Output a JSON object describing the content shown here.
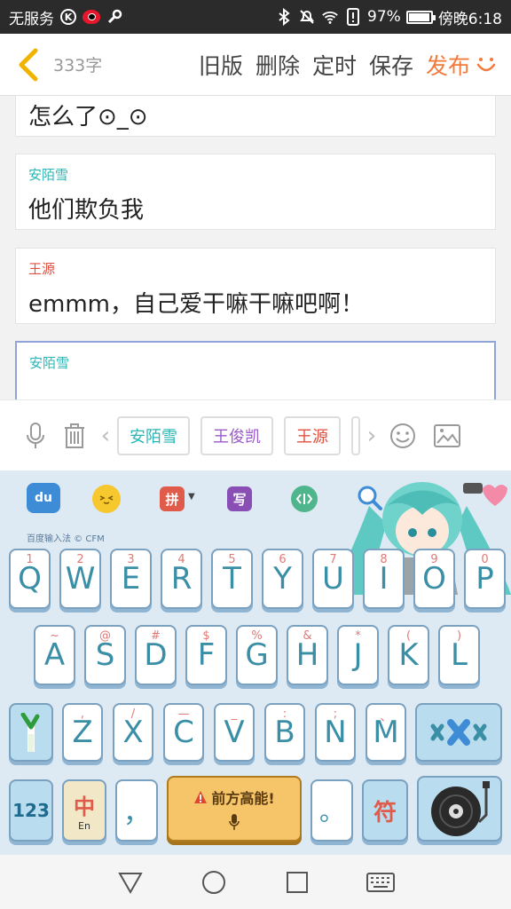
{
  "status_bar": {
    "carrier": "无服务",
    "battery_percent": "97%",
    "time": "傍晚6:18",
    "battery_level": 0.97,
    "icons": [
      "k-circle-icon",
      "weibo-icon",
      "wrench-icon",
      "bluetooth-icon",
      "mute-icon",
      "wifi-icon",
      "alert-icon",
      "battery-icon"
    ]
  },
  "header": {
    "word_count": "333字",
    "actions": [
      "旧版",
      "删除",
      "定时",
      "保存"
    ],
    "publish": "发布"
  },
  "messages": [
    {
      "speaker": "",
      "text": "怎么了⊙_⊙",
      "speaker_color": "#2bb5b5"
    },
    {
      "speaker": "安陌雪",
      "text": "他们欺负我",
      "speaker_color": "#2bb5b5"
    },
    {
      "speaker": "王源",
      "text": "emmm，自己爱干嘛干嘛吧啊！",
      "speaker_color": "#e05040"
    },
    {
      "speaker": "安陌雪",
      "text": "",
      "speaker_color": "#2bb5b5"
    }
  ],
  "quick_row": {
    "chips": [
      {
        "label": "安陌雪",
        "color": "#2bb5b5"
      },
      {
        "label": "王俊凯",
        "color": "#9a5ac8"
      },
      {
        "label": "王源",
        "color": "#e05040"
      }
    ]
  },
  "keyboard": {
    "brand": "百度输入法 © CFM",
    "toolbar": {
      "pinyin": "拼",
      "handwrite": "写",
      "du": "du"
    },
    "row1": [
      {
        "k": "Q",
        "s": "1"
      },
      {
        "k": "W",
        "s": "2"
      },
      {
        "k": "E",
        "s": "3"
      },
      {
        "k": "R",
        "s": "4"
      },
      {
        "k": "T",
        "s": "5"
      },
      {
        "k": "Y",
        "s": "6"
      },
      {
        "k": "U",
        "s": "7"
      },
      {
        "k": "I",
        "s": "8"
      },
      {
        "k": "O",
        "s": "9"
      },
      {
        "k": "P",
        "s": "0"
      }
    ],
    "row2": [
      {
        "k": "A",
        "s": "~"
      },
      {
        "k": "S",
        "s": "@"
      },
      {
        "k": "D",
        "s": "#"
      },
      {
        "k": "F",
        "s": "$"
      },
      {
        "k": "G",
        "s": "%"
      },
      {
        "k": "H",
        "s": "&"
      },
      {
        "k": "J",
        "s": "*"
      },
      {
        "k": "K",
        "s": "("
      },
      {
        "k": "L",
        "s": ")"
      }
    ],
    "row3": [
      {
        "k": "Z",
        "s": ","
      },
      {
        "k": "X",
        "s": "/"
      },
      {
        "k": "C",
        "s": "—"
      },
      {
        "k": "V",
        "s": "_"
      },
      {
        "k": "B",
        "s": ":"
      },
      {
        "k": "N",
        "s": ";"
      },
      {
        "k": "M",
        "s": "、"
      }
    ],
    "num_key": "123",
    "lang_key_cn": "中",
    "lang_key_en": "En",
    "comma_key": "，",
    "space_label": "前方高能!",
    "period_key": "。",
    "symbol_key": "符"
  }
}
